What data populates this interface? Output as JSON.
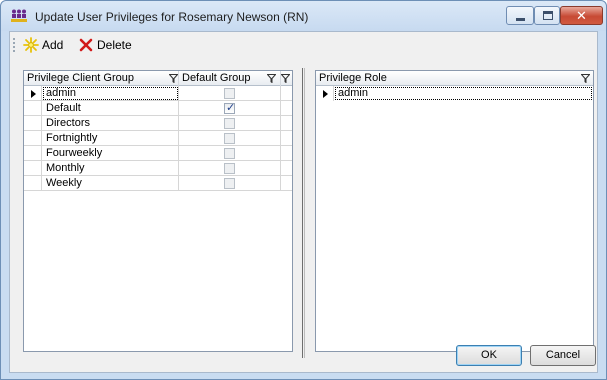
{
  "window": {
    "title": "Update User Privileges for Rosemary Newson (RN)",
    "controls": {
      "minimize": "minimize",
      "maximize": "maximize",
      "close": "✕"
    }
  },
  "toolbar": {
    "add_label": "Add",
    "delete_label": "Delete"
  },
  "client_groups_grid": {
    "columns": [
      "Privilege Client Group",
      "Default Group"
    ],
    "rows": [
      {
        "name": "admin",
        "default": false,
        "current": true
      },
      {
        "name": "Default",
        "default": true,
        "current": false
      },
      {
        "name": "Directors",
        "default": false,
        "current": false
      },
      {
        "name": "Fortnightly",
        "default": false,
        "current": false
      },
      {
        "name": "Fourweekly",
        "default": false,
        "current": false
      },
      {
        "name": "Monthly",
        "default": false,
        "current": false
      },
      {
        "name": "Weekly",
        "default": false,
        "current": false
      }
    ]
  },
  "roles_grid": {
    "columns": [
      "Privilege Role"
    ],
    "rows": [
      {
        "name": "admin",
        "current": true
      }
    ]
  },
  "buttons": {
    "ok_label": "OK",
    "cancel_label": "Cancel"
  },
  "colors": {
    "title_bg": "#c7daf0",
    "close_button": "#c74a34",
    "add_icon": "#e8c20a",
    "delete_icon": "#d11a1a"
  }
}
